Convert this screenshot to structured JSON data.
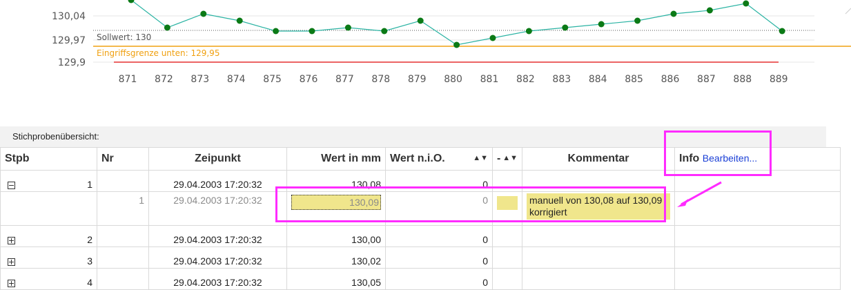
{
  "chart": {
    "y_ticks": [
      "130,04",
      "129,97",
      "129,9"
    ],
    "x_labels": [
      "871",
      "872",
      "873",
      "874",
      "875",
      "876",
      "877",
      "878",
      "879",
      "880",
      "881",
      "882",
      "883",
      "884",
      "885",
      "886",
      "887",
      "888",
      "889"
    ],
    "values": [
      130.08,
      130.0,
      130.04,
      130.02,
      129.99,
      129.99,
      130.0,
      129.99,
      130.02,
      129.95,
      129.97,
      129.99,
      130.0,
      130.01,
      130.02,
      130.04,
      130.05,
      130.07,
      129.99
    ],
    "sollwert_label": "Sollwert: 130",
    "eingriff_label": "Eingriffsgrenze unten: 129,95",
    "colors": {
      "line": "#2ab3a3",
      "point": "#0b7a16",
      "eingriff": "#f0a010",
      "lower": "#e53030",
      "sollwert": "#555555"
    }
  },
  "section_title": "Stichprobenübersicht:",
  "table": {
    "headers": {
      "stpb": "Stpb",
      "nr": "Nr",
      "zeitpunkt": "Zeipunkt",
      "wert": "Wert in mm",
      "wert_nio": "Wert n.i.O.",
      "dash": "-",
      "kommentar": "Kommentar",
      "info": "Info",
      "info_link": "Bearbeiten..."
    },
    "rows": [
      {
        "stpb": "1",
        "zeit": "29.04.2003 17:20:32",
        "wert": "130,08",
        "nio": "0"
      },
      {
        "stpb": "2",
        "zeit": "29.04.2003 17:20:32",
        "wert": "130,00",
        "nio": "0"
      },
      {
        "stpb": "3",
        "zeit": "29.04.2003 17:20:32",
        "wert": "130,02",
        "nio": "0"
      },
      {
        "stpb": "4",
        "zeit": "29.04.2003 17:20:32",
        "wert": "130,05",
        "nio": "0"
      }
    ],
    "subrow": {
      "nr": "1",
      "zeit": "29.04.2003 17:20:32",
      "wert": "130,09",
      "nio": "0",
      "kommentar": "manuell von 130,08 auf 130,09 korrigiert"
    }
  }
}
